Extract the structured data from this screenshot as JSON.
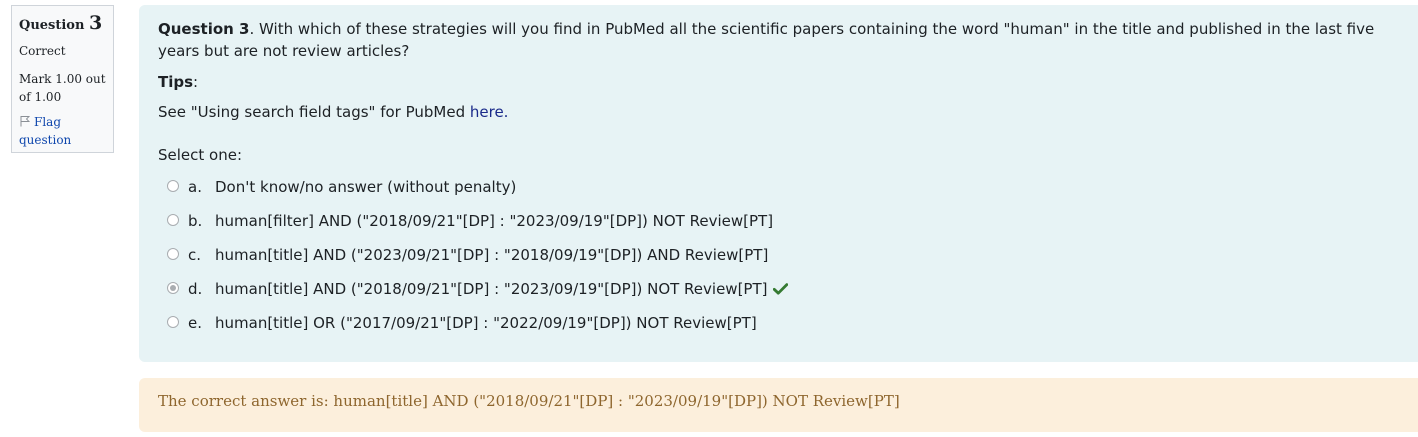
{
  "info": {
    "question_word": "Question",
    "question_number": "3",
    "state": "Correct",
    "grade": "Mark 1.00 out of 1.00",
    "flag_label": "Flag question"
  },
  "question": {
    "label": "Question 3",
    "text": ". With which of these strategies will you find in PubMed all the scientific papers containing the word \"human\" in the title and published in the last five years but are not review articles?",
    "tips_label": "Tips",
    "tips_colon": ":",
    "see_prefix": "See \"Using search field tags\" for PubMed ",
    "see_link": "here.",
    "prompt": "Select one:"
  },
  "answers": [
    {
      "letter": "a.",
      "text": "Don't know/no answer (without penalty)",
      "checked": false,
      "correct": false
    },
    {
      "letter": "b.",
      "text": "human[filter] AND (\"2018/09/21\"[DP] : \"2023/09/19\"[DP]) NOT Review[PT]",
      "checked": false,
      "correct": false
    },
    {
      "letter": "c.",
      "text": "human[title] AND (\"2023/09/21\"[DP] : \"2018/09/19\"[DP]) AND Review[PT]",
      "checked": false,
      "correct": false
    },
    {
      "letter": "d.",
      "text": "human[title] AND (\"2018/09/21\"[DP] : \"2023/09/19\"[DP]) NOT Review[PT]",
      "checked": true,
      "correct": true
    },
    {
      "letter": "e.",
      "text": "human[title] OR (\"2017/09/21\"[DP] : \"2022/09/19\"[DP]) NOT Review[PT]",
      "checked": false,
      "correct": false
    }
  ],
  "feedback": {
    "text": "The correct answer is: human[title] AND (\"2018/09/21\"[DP] : \"2023/09/19\"[DP]) NOT Review[PT]"
  },
  "colors": {
    "content_bg": "#e7f3f5",
    "feedback_bg": "#fcefdc",
    "feedback_text": "#8e662e",
    "link": "#1a2a8a",
    "correct_tick": "#357a32"
  },
  "icons": {
    "flag": "flag-icon",
    "correct": "check-icon"
  }
}
